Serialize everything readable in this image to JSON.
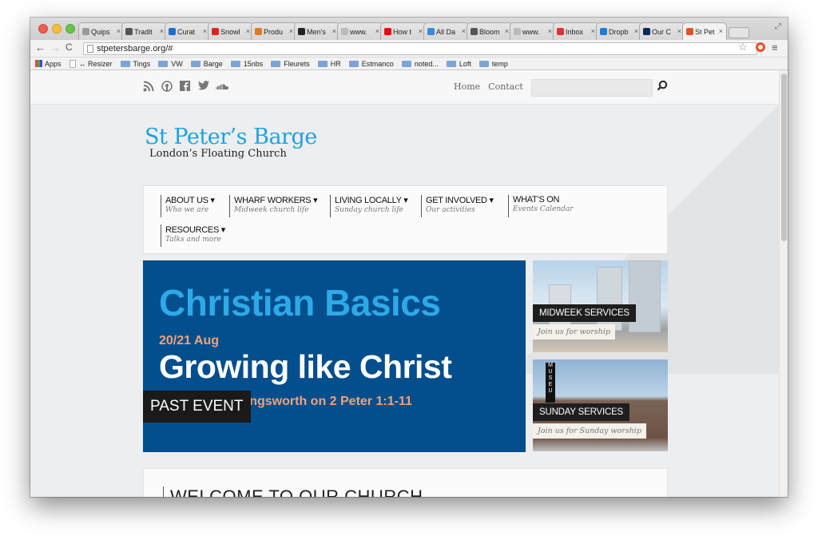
{
  "browser": {
    "tabs": [
      {
        "title": "Quips",
        "icon": "document-icon",
        "color": "#999999"
      },
      {
        "title": "Tradit",
        "icon": "pen-icon",
        "color": "#555555"
      },
      {
        "title": "Curat",
        "icon": "circle-o-icon",
        "color": "#1b6fd1"
      },
      {
        "title": "Snowl",
        "icon": "snow-icon",
        "color": "#d22"
      },
      {
        "title": "Produ",
        "icon": "triangle-icon",
        "color": "#e07a20"
      },
      {
        "title": "Men's",
        "icon": "mtm-icon",
        "color": "#222222"
      },
      {
        "title": "www.",
        "icon": "document-icon",
        "color": "#bbbbbb"
      },
      {
        "title": "How t",
        "icon": "adobe-icon",
        "color": "#d11"
      },
      {
        "title": "All Da",
        "icon": "bi-icon",
        "color": "#3a8ad8"
      },
      {
        "title": "Bloom",
        "icon": "wine-icon",
        "color": "#555555"
      },
      {
        "title": "www.",
        "icon": "document-icon",
        "color": "#bbbbbb"
      },
      {
        "title": "Inbox",
        "icon": "gmail-icon",
        "color": "#d33"
      },
      {
        "title": "Dropb",
        "icon": "dropbox-icon",
        "color": "#1e7be0"
      },
      {
        "title": "Our C",
        "icon": "square-icon",
        "color": "#0a2a5a"
      },
      {
        "title": "St Pet",
        "icon": "lifering-icon",
        "color": "#e8502b"
      }
    ],
    "url": "stpetersbarge.org/#",
    "bookmarks": [
      {
        "label": "Apps",
        "type": "apps"
      },
      {
        "label": "↔ Resizer",
        "type": "page"
      },
      {
        "label": "Tings",
        "type": "folder"
      },
      {
        "label": "VW",
        "type": "folder"
      },
      {
        "label": "Barge",
        "type": "folder"
      },
      {
        "label": "15nbs",
        "type": "folder"
      },
      {
        "label": "Fleurets",
        "type": "folder"
      },
      {
        "label": "HR",
        "type": "folder"
      },
      {
        "label": "Estmanco",
        "type": "folder"
      },
      {
        "label": "noted...",
        "type": "folder"
      },
      {
        "label": "Loft",
        "type": "folder"
      },
      {
        "label": "temp",
        "type": "folder"
      }
    ]
  },
  "site": {
    "social_icons": [
      "rss-icon",
      "podcast-icon",
      "facebook-icon",
      "twitter-icon",
      "soundcloud-icon"
    ],
    "topnav": {
      "home": "Home",
      "contact": "Contact"
    },
    "search": {
      "placeholder": ""
    },
    "logo": {
      "title": "St Peter’s Barge",
      "subtitle": "London’s Floating Church"
    },
    "nav": [
      {
        "label": "ABOUT US ▾",
        "sub": "Who we are"
      },
      {
        "label": "WHARF WORKERS ▾",
        "sub": "Midweek church life"
      },
      {
        "label": "LIVING LOCALLY ▾",
        "sub": "Sunday church life"
      },
      {
        "label": "GET INVOLVED ▾",
        "sub": "Our activities"
      },
      {
        "label": "WHAT’S ON",
        "sub": "Events Calendar"
      },
      {
        "label": "RESOURCES ▾",
        "sub": "Talks and more"
      }
    ],
    "hero": {
      "title": "Christian Basics",
      "date": "20/21 Aug",
      "subtitle": "Growing like Christ",
      "speaker": "Talk by Wes Illingsworth on 2 Peter 1:1-11",
      "badge": "PAST EVENT"
    },
    "cards": [
      {
        "label": "MIDWEEK SERVICES",
        "sub": "Join us for worship"
      },
      {
        "label": "SUNDAY SERVICES",
        "sub": "Join us for Sunday worship"
      }
    ],
    "welcome": {
      "title": "WELCOME TO OUR CHURCH"
    }
  }
}
